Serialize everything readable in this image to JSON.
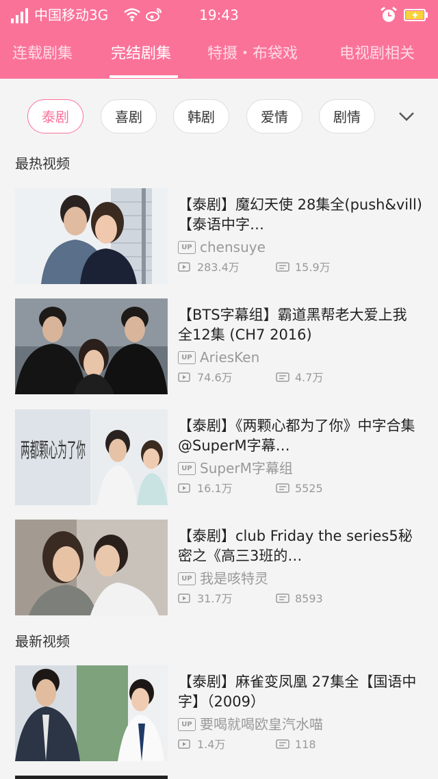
{
  "status_bar": {
    "carrier": "中国移动3G",
    "time": "19:43"
  },
  "tabs": [
    {
      "label": "连载剧集"
    },
    {
      "label": "完结剧集"
    },
    {
      "label": "特摄・布袋戏"
    },
    {
      "label": "电视剧相关"
    }
  ],
  "chips": [
    {
      "label": "泰剧"
    },
    {
      "label": "喜剧"
    },
    {
      "label": "韩剧"
    },
    {
      "label": "爱情"
    },
    {
      "label": "剧情"
    }
  ],
  "sections": {
    "hot_title": "最热视频",
    "new_title": "最新视频"
  },
  "up_badge": "UP",
  "videos": [
    {
      "title": "【泰剧】魔幻天使 28集全(push&vill)【泰语中字…",
      "uploader": "chensuye",
      "plays": "283.4万",
      "danmaku": "15.9万"
    },
    {
      "title": "【BTS字幕组】霸道黑帮老大爱上我 全12集 (CH7 2016)",
      "uploader": "AriesKen",
      "plays": "74.6万",
      "danmaku": "4.7万"
    },
    {
      "title": "【泰剧】《两颗心都为了你》中字合集 @SuperM字幕…",
      "uploader": "SuperM字幕组",
      "plays": "16.1万",
      "danmaku": "5525"
    },
    {
      "title": "【泰剧】club Friday the series5秘密之《高三3班的…",
      "uploader": "我是咳特灵",
      "plays": "31.7万",
      "danmaku": "8593"
    },
    {
      "title": "【泰剧】麻雀变凤凰 27集全【国语中字】（2009）",
      "uploader": "要喝就喝欧皇汽水喵",
      "plays": "1.4万",
      "danmaku": "118"
    }
  ],
  "thumb3_text": "两都颗心为了你",
  "colors": {
    "accent": "#fb7299",
    "text_secondary": "#999999"
  }
}
